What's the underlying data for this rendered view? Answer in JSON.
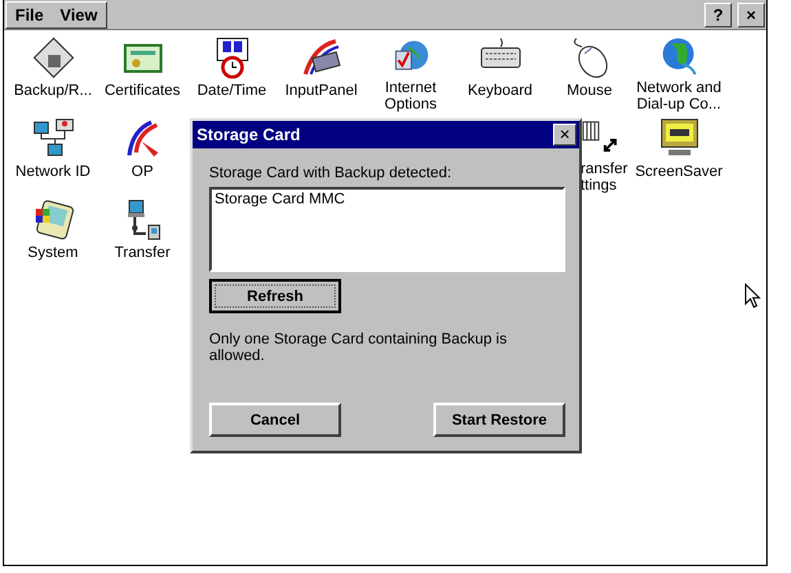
{
  "window": {
    "menu": [
      {
        "label": "File"
      },
      {
        "label": "View"
      }
    ],
    "title_buttons": [
      {
        "label": "?"
      },
      {
        "label": "×"
      }
    ]
  },
  "desktop": {
    "rows": [
      {
        "items": [
          {
            "label": "Backup/R...",
            "kind": "icon"
          },
          {
            "label": "Certificates",
            "kind": "icon"
          },
          {
            "label": "Date/Time",
            "kind": "icon"
          },
          {
            "label": "InputPanel",
            "kind": "icon"
          },
          {
            "label": "Internet\nOptions",
            "kind": "icon"
          },
          {
            "label": "Keyboard",
            "kind": "icon"
          },
          {
            "label": "Mouse",
            "kind": "icon"
          },
          {
            "label": "Network and\nDial-up Co...",
            "kind": "icon"
          }
        ]
      },
      {
        "items": [
          {
            "label": "Network ID",
            "kind": "icon"
          },
          {
            "label": "OP",
            "kind": "icon"
          },
          {
            "label": "ransfer\nttings",
            "kind": "partial"
          },
          {
            "label": "ScreenSaver",
            "kind": "icon"
          }
        ]
      },
      {
        "items": [
          {
            "label": "System",
            "kind": "icon"
          },
          {
            "label": "Transfer",
            "kind": "icon"
          }
        ]
      }
    ]
  },
  "dialog": {
    "title": "Storage Card",
    "close": "×",
    "prompt": "Storage Card with Backup detected:",
    "list_items": [
      {
        "label": "Storage Card MMC",
        "selected": false
      }
    ],
    "refresh": {
      "label": "Refresh",
      "focused": true
    },
    "note": "Only one Storage Card containing Backup is allowed.",
    "buttons": [
      {
        "label": "Cancel"
      },
      {
        "label": "Start Restore"
      }
    ]
  }
}
